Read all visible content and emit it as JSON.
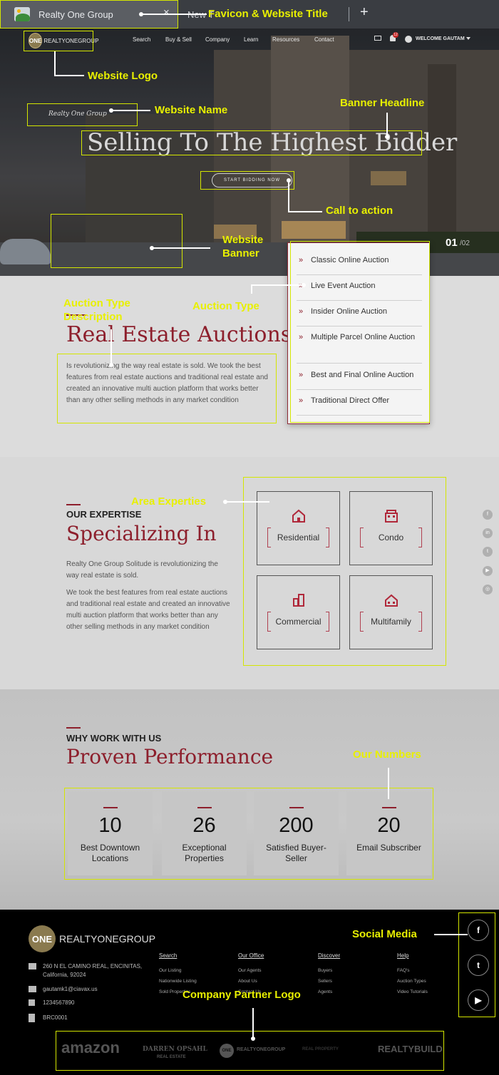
{
  "browser": {
    "tab_title": "Realty One Group",
    "tab_close": "×",
    "tab2_title": "New T",
    "new_tab": "+"
  },
  "site": {
    "logo_mark": "ONE",
    "logo_word": "REALTYONEGROUP",
    "nav": [
      "Search",
      "Buy & Sell",
      "Company",
      "Learn",
      "Resources",
      "Contact"
    ],
    "notification_count": "12",
    "welcome": "WELCOME GAUTAM",
    "site_name": "Realty One Group",
    "headline": "Selling To The Highest Bidder",
    "cta": "START BIDDING NOW",
    "slide_current": "01",
    "slide_total": "/02"
  },
  "auction": {
    "types": [
      "Classic Online Auction",
      "Live Event Auction",
      "Insider Online Auction",
      "Multiple Parcel Online Auction",
      "Best and Final Online Auction",
      "Traditional Direct Offer"
    ],
    "title": "Real Estate Auctions",
    "description": "Is revolutionizing the way real estate is sold. We took the best features from real estate auctions and traditional real estate and created an innovative multi auction platform that works better than any other selling methods in any market condition"
  },
  "expertise": {
    "kicker": "OUR EXPERTISE",
    "title": "Specializing In",
    "p1": "Realty One Group Solitude is revolutionizing the way real estate is sold.",
    "p2": "We took the best features from real estate auctions and traditional real estate and created an innovative multi auction platform that works better than any other selling methods in any market condition",
    "areas": [
      "Residential",
      "Condo",
      "Commercial",
      "Multifamily"
    ],
    "area_icons": [
      "house-icon",
      "condo-building-icon",
      "office-tower-icon",
      "multifamily-home-icon"
    ],
    "side_social": [
      "f",
      "in",
      "t",
      "▶",
      "◎"
    ]
  },
  "performance": {
    "kicker": "WHY WORK WITH US",
    "title": "Proven Performance",
    "stats": [
      {
        "value": "10",
        "label": "Best Downtown Locations"
      },
      {
        "value": "26",
        "label": "Exceptional Properties"
      },
      {
        "value": "200",
        "label": "Satisfied Buyer-Seller"
      },
      {
        "value": "20",
        "label": "Email Subscriber"
      }
    ]
  },
  "footer": {
    "logo_mark": "ONE",
    "logo_word": "REALTYONEGROUP",
    "address": "260 N EL CAMINO REAL, ENCINITAS, California, 92024",
    "email": "gautamk1@ciavax.us",
    "phone": "1234567890",
    "license": "BRC0001",
    "columns": [
      {
        "heading": "Search",
        "links": [
          "Our Listing",
          "Nationwide Listing",
          "Sold Properties"
        ]
      },
      {
        "heading": "Our Office",
        "links": [
          "Our Agents",
          "About Us",
          "Contact Us"
        ]
      },
      {
        "heading": "Discover",
        "links": [
          "Buyers",
          "Sellers",
          "Agents"
        ]
      },
      {
        "heading": "Help",
        "links": [
          "FAQ's",
          "Auction Types",
          "Video Tutorials"
        ]
      }
    ],
    "social": [
      "f",
      "t",
      "▶"
    ],
    "partners": [
      "amazon",
      "DARREN OPSAHL",
      "REAL ESTATE",
      "ONE",
      "REALTYONEGROUP",
      "REAL PROPERTY",
      "REALTYBUILD"
    ]
  },
  "annotations": {
    "favicon_title": "Favicon & Website Title",
    "logo": "Website Logo",
    "site_name": "Website Name",
    "headline": "Banner Headline",
    "cta": "Call to action",
    "banner": "Website Banner",
    "auction_type_desc": "Auction Type Description",
    "auction_type": "Auction Type",
    "area_experties": "Area Experties",
    "our_numbers": "Our Numbers",
    "social_media": "Social Media",
    "partner_logo": "Company Partner Logo"
  },
  "colors": {
    "brand_red": "#8d1f2c",
    "annotation_yellow": "#e8f000",
    "logo_gold": "#8a7a4f"
  }
}
